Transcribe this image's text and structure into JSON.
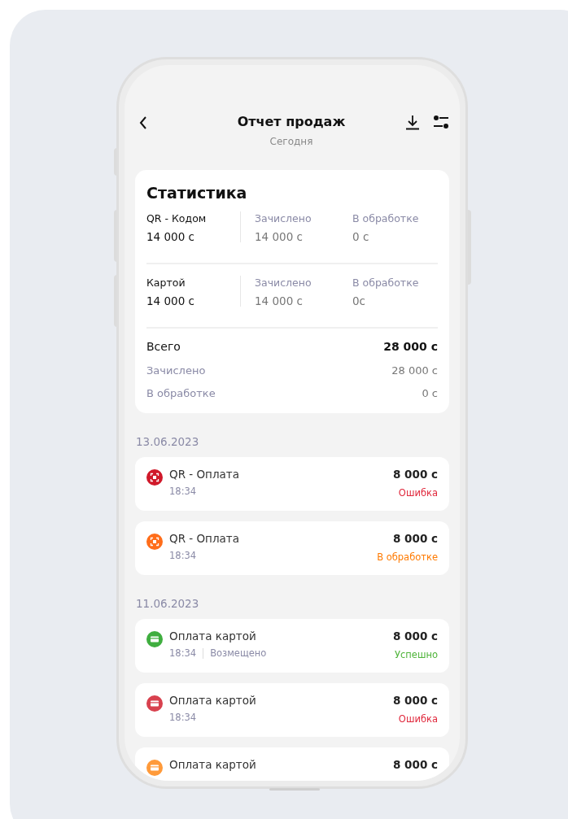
{
  "header": {
    "title": "Отчет продаж",
    "subtitle": "Сегодня"
  },
  "stats": {
    "title": "Статистика",
    "groups": [
      {
        "label": "QR - Кодом",
        "value": "14 000 с",
        "credited_label": "Зачислено",
        "credited": "14 000 с",
        "pending_label": "В обработке",
        "pending": "0 с"
      },
      {
        "label": "Картой",
        "value": "14 000 с",
        "credited_label": "Зачислено",
        "credited": "14 000 с",
        "pending_label": "В обработке",
        "pending": "0с"
      }
    ],
    "totals": [
      {
        "kind": "main",
        "label": "Всего",
        "value": "28 000 с"
      },
      {
        "kind": "sub",
        "label": "Зачислено",
        "value": "28 000 с"
      },
      {
        "kind": "sub",
        "label": "В обработке",
        "value": "0 с"
      }
    ]
  },
  "days": [
    {
      "date": "13.06.2023",
      "transactions": [
        {
          "kind": "qr",
          "color": "#d0192a",
          "title": "QR - Оплата",
          "time": "18:34",
          "amount": "8 000 с",
          "status": {
            "label": "Ошибка",
            "color": "#e0283c"
          }
        },
        {
          "kind": "qr",
          "color": "#ff6d1a",
          "title": "QR - Оплата",
          "time": "18:34",
          "amount": "8 000 с",
          "status": {
            "label": "В обработке",
            "color": "#ff7a00"
          }
        }
      ]
    },
    {
      "date": "11.06.2023",
      "transactions": [
        {
          "kind": "card",
          "color": "#3fae3f",
          "title": "Оплата картой",
          "time": "18:34",
          "note": "Возмещено",
          "amount": "8 000 с",
          "status": {
            "label": "Успешно",
            "color": "#4fb43a"
          }
        },
        {
          "kind": "card",
          "color": "#d8414e",
          "title": "Оплата картой",
          "time": "18:34",
          "amount": "8 000 с",
          "status": {
            "label": "Ошибка",
            "color": "#e0283c"
          }
        },
        {
          "kind": "card",
          "color": "#ff9a3a",
          "title": "Оплата картой",
          "amount": "8 000 с"
        }
      ]
    }
  ]
}
